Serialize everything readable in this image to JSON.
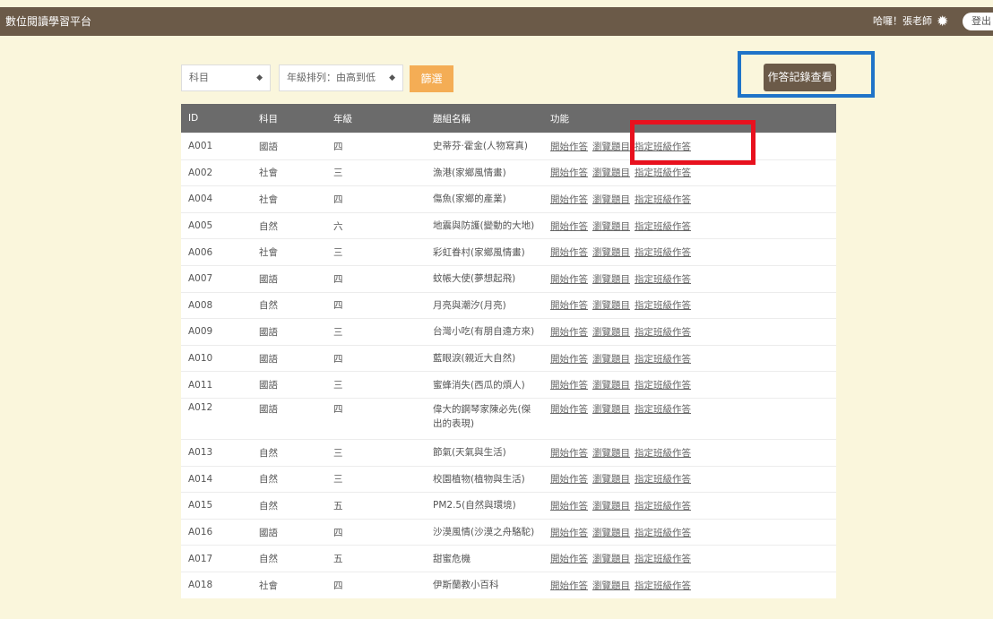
{
  "header": {
    "brand": "數位閱讀學習平台",
    "greeting": "哈囉！張老師",
    "gear_icon": "gear-icon",
    "logout_label": "登出"
  },
  "filters": {
    "subject": "科目",
    "grade_sort": "年級排列：由高到低",
    "filter_label": "篩選",
    "records_label": "作答記錄查看"
  },
  "table": {
    "columns": [
      "ID",
      "科目",
      "年級",
      "題組名稱",
      "功能"
    ],
    "actions": [
      "開始作答",
      "瀏覽題目",
      "指定班級作答"
    ],
    "rows": [
      {
        "id": "A001",
        "subject": "國語",
        "grade": "四",
        "title": "史蒂芬‧霍金(人物寫真)"
      },
      {
        "id": "A002",
        "subject": "社會",
        "grade": "三",
        "title": "漁港(家鄉風情畫)"
      },
      {
        "id": "A004",
        "subject": "社會",
        "grade": "四",
        "title": "傷魚(家鄉的產業)"
      },
      {
        "id": "A005",
        "subject": "自然",
        "grade": "六",
        "title": "地震與防護(變動的大地)"
      },
      {
        "id": "A006",
        "subject": "社會",
        "grade": "三",
        "title": "彩虹眷村(家鄉風情畫)"
      },
      {
        "id": "A007",
        "subject": "國語",
        "grade": "四",
        "title": "蚊帳大使(夢想起飛)"
      },
      {
        "id": "A008",
        "subject": "自然",
        "grade": "四",
        "title": "月亮與潮汐(月亮)"
      },
      {
        "id": "A009",
        "subject": "國語",
        "grade": "三",
        "title": "台灣小吃(有朋自遠方來)"
      },
      {
        "id": "A010",
        "subject": "國語",
        "grade": "四",
        "title": "藍眼淚(親近大自然)"
      },
      {
        "id": "A011",
        "subject": "國語",
        "grade": "三",
        "title": "蜜蜂消失(西瓜的煩人)"
      },
      {
        "id": "A012",
        "subject": "國語",
        "grade": "四",
        "title": "偉大的鋼琴家陳必先(傑出的表現)",
        "tall": true
      },
      {
        "id": "A013",
        "subject": "自然",
        "grade": "三",
        "title": "節氣(天氣與生活)"
      },
      {
        "id": "A014",
        "subject": "自然",
        "grade": "三",
        "title": "校園植物(植物與生活)"
      },
      {
        "id": "A015",
        "subject": "自然",
        "grade": "五",
        "title": "PM2.5(自然與環境)"
      },
      {
        "id": "A016",
        "subject": "國語",
        "grade": "四",
        "title": "沙漠風情(沙漠之舟駱駝)"
      },
      {
        "id": "A017",
        "subject": "自然",
        "grade": "五",
        "title": "甜蜜危機"
      },
      {
        "id": "A018",
        "subject": "社會",
        "grade": "四",
        "title": "伊斯蘭教小百科"
      }
    ]
  }
}
